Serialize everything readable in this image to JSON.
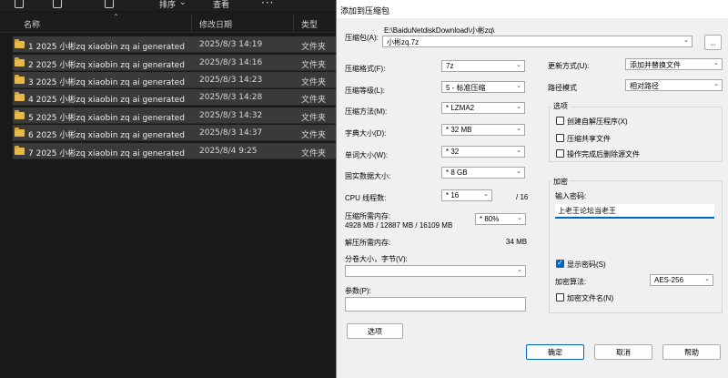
{
  "toolbar": {
    "sort_label": "排序",
    "view_label": "查看",
    "more_label": "···"
  },
  "columns": {
    "name": "名称",
    "date": "修改日期",
    "type": "类型"
  },
  "files": [
    {
      "name": "1 2025 小彬zq xiaobin zq ai generated",
      "date": "2025/8/3 14:19",
      "type": "文件夹"
    },
    {
      "name": "2 2025 小彬zq xiaobin zq ai generated",
      "date": "2025/8/3 14:16",
      "type": "文件夹"
    },
    {
      "name": "3 2025 小彬zq xiaobin zq ai generated",
      "date": "2025/8/3 14:23",
      "type": "文件夹"
    },
    {
      "name": "4 2025 小彬zq xiaobin zq ai generated",
      "date": "2025/8/3 14:28",
      "type": "文件夹"
    },
    {
      "name": "5 2025 小彬zq xiaobin zq ai generated",
      "date": "2025/8/3 14:32",
      "type": "文件夹"
    },
    {
      "name": "6 2025 小彬zq xiaobin zq ai generated",
      "date": "2025/8/3 14:37",
      "type": "文件夹"
    },
    {
      "name": "7 2025 小彬zq xiaobin zq ai generated",
      "date": "2025/8/4 9:25",
      "type": "文件夹"
    }
  ],
  "dialog": {
    "title": "添加到压缩包",
    "archive_label": "压缩包(A):",
    "archive_path": "E:\\BaiduNetdiskDownload\\小彬zq\\",
    "archive_name": "小彬zq.7z",
    "browse_label": "...",
    "format_label": "压缩格式(F):",
    "format_value": "7z",
    "level_label": "压缩等级(L):",
    "level_value": "5 - 标准压缩",
    "method_label": "压缩方法(M):",
    "method_value": "* LZMA2",
    "dict_label": "字典大小(D):",
    "dict_value": "* 32 MB",
    "word_label": "单词大小(W):",
    "word_value": "* 32",
    "solid_label": "固实数据大小:",
    "solid_value": "* 8 GB",
    "threads_label": "CPU 线程数:",
    "threads_value": "* 16",
    "threads_total": "/ 16",
    "mem_comp_label": "压缩所需内存:",
    "mem_comp_detail": "4928 MB / 12887 MB / 16109 MB",
    "mem_comp_value": "* 80%",
    "mem_decomp_label": "解压所需内存:",
    "mem_decomp_value": "34 MB",
    "split_label": "分卷大小，字节(V):",
    "params_label": "参数(P):",
    "options_button": "选项",
    "update_label": "更新方式(U):",
    "update_value": "添加并替换文件",
    "path_mode_label": "路径模式",
    "path_mode_value": "相对路径",
    "options_group_title": "选项",
    "opt_sfx": "创建自解压程序(X)",
    "opt_shared": "压缩共享文件",
    "opt_delete": "操作完成后删除源文件",
    "encrypt_group_title": "加密",
    "password_label": "输入密码:",
    "password_value": "上老王论坛当老王",
    "show_password": "显示密码(S)",
    "enc_method_label": "加密算法:",
    "enc_method_value": "AES-256",
    "encrypt_names": "加密文件名(N)",
    "ok_button": "确定",
    "cancel_button": "取消",
    "help_button": "帮助"
  }
}
